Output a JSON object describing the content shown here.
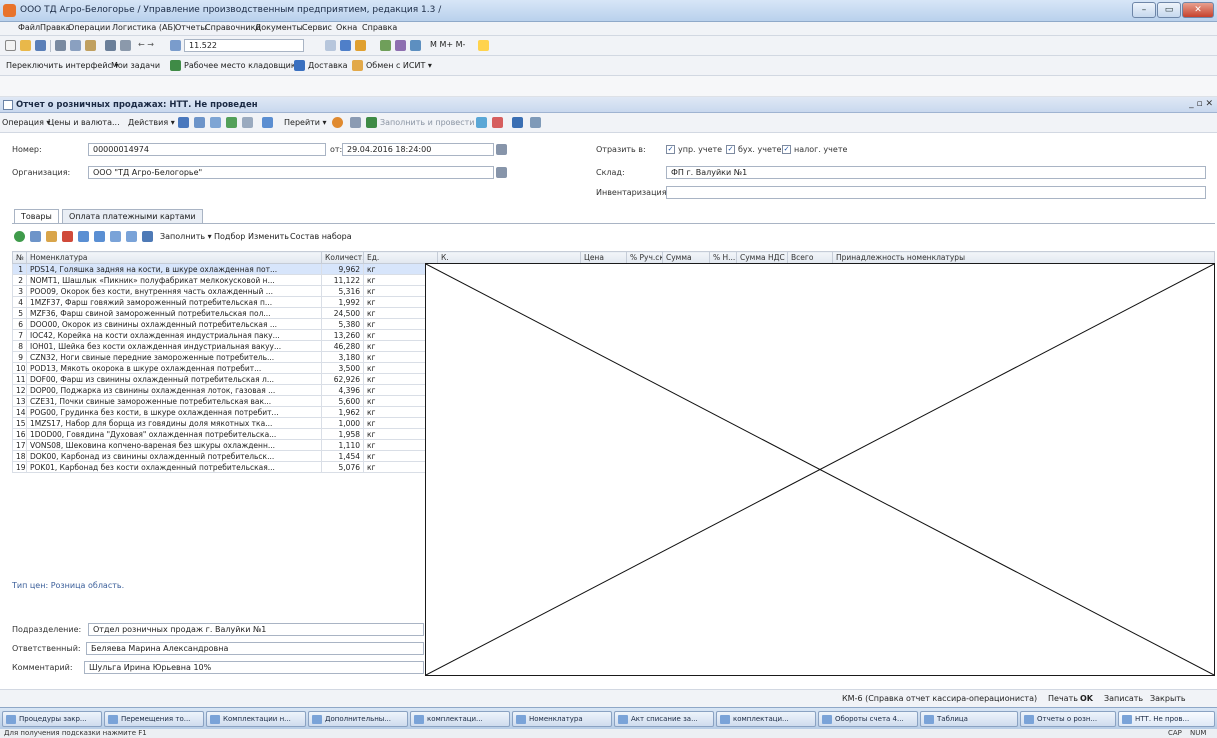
{
  "window": {
    "title": "ООО ТД Агро-Белогорье / Управление производственным предприятием, редакция 1.3 /",
    "min": "–",
    "max": "▭",
    "close": "✕"
  },
  "menu": [
    "Файл",
    "Правка",
    "Операции",
    "Логистика (АБ)",
    "Отчеты",
    "Справочники",
    "Документы",
    "Сервис",
    "Окна",
    "Справка"
  ],
  "toolbar1": {
    "search_value": "11.522",
    "calc": "M  M+  M-"
  },
  "toolbar2": {
    "switch_interface": "Переключить интерфейс ▾",
    "my_tasks": "Мои задачи",
    "warehouse": "Рабочее место кладовщика",
    "delivery": "Доставка",
    "exchange": "Обмен с ИСИТ ▾"
  },
  "doc": {
    "title": "Отчет о розничных продажах: НТТ. Не проведен",
    "close_controls": "_ ▫ ✕"
  },
  "doc_toolbar": {
    "operation": "Операция ▾",
    "prices": "Цены и валюта...",
    "actions": "Действия ▾",
    "goto": "Перейти ▾",
    "fill_post": "Заполнить и провести"
  },
  "form": {
    "number_label": "Номер:",
    "number_value": "00000014974",
    "date_label": "от:",
    "date_value": "29.04.2016 18:24:00",
    "org_label": "Организация:",
    "org_value": "ООО \"ТД Агро-Белогорье\"",
    "reflect_label": "Отразить в:",
    "reflect_mgmt": "упр. учете",
    "reflect_acc": "бух. учете",
    "reflect_tax": "налог. учете",
    "warehouse_label": "Склад:",
    "warehouse_value": "ФП г. Валуйки №1",
    "inventory_label": "Инвентаризация:",
    "inventory_value": ""
  },
  "tabs": [
    "Товары",
    "Оплата платежными картами"
  ],
  "grid_toolbar": {
    "fill": "Заполнить ▾",
    "pick": "Подбор",
    "change": "Изменить",
    "set": "Состав набора"
  },
  "grid": {
    "columns": [
      "№",
      "Номенклатура",
      "Количест...",
      "Ед.",
      "К.",
      "Цена",
      "% Руч.ск.",
      "Сумма",
      "% Н...",
      "Сумма НДС",
      "Всего",
      "Принадлежность номенклатуры"
    ],
    "rows": [
      [
        "1",
        "PDS14, Голяшка задняя на кости, в шкуре охлажденная пот...",
        "9,962",
        "кг"
      ],
      [
        "2",
        "NOMT1, Шашлык «Пикник» полуфабрикат мелкокусковой н...",
        "11,122",
        "кг"
      ],
      [
        "3",
        "POO09, Окорок без кости, внутренняя часть охлажденный ...",
        "5,316",
        "кг"
      ],
      [
        "4",
        "1MZF37, Фарш говяжий замороженный потребительская п...",
        "1,992",
        "кг"
      ],
      [
        "5",
        "MZF36, Фарш свиной замороженный потребительская пол...",
        "24,500",
        "кг"
      ],
      [
        "6",
        "DOO00, Окорок из свинины охлажденный потребительская ...",
        "5,380",
        "кг"
      ],
      [
        "7",
        "IOC42, Корейка на кости охлажденная индустриальная паку...",
        "13,260",
        "кг"
      ],
      [
        "8",
        "IOH01, Шейка без кости охлажденная индустриальная вакуу...",
        "46,280",
        "кг"
      ],
      [
        "9",
        "CZN32, Ноги свиные передние замороженные потребитель...",
        "3,180",
        "кг"
      ],
      [
        "10",
        "POD13, Мякоть окорока в шкуре охлажденная потребит...",
        "3,500",
        "кг"
      ],
      [
        "11",
        "DOF00, Фарш из свинины охлажденный потребительская л...",
        "62,926",
        "кг"
      ],
      [
        "12",
        "DOP00, Поджарка из свинины охлажденная лоток, газовая ...",
        "4,396",
        "кг"
      ],
      [
        "13",
        "CZE31, Почки свиные замороженные потребительская вак...",
        "5,600",
        "кг"
      ],
      [
        "14",
        "POG00, Грудинка без кости, в шкуре охлажденная потребит...",
        "1,962",
        "кг"
      ],
      [
        "15",
        "1MZS17, Набор для борща из говядины доля мякотных тка...",
        "1,000",
        "кг"
      ],
      [
        "16",
        "1DOD00, Говядина \"Духовая\" охлажденная потребительска...",
        "1,958",
        "кг"
      ],
      [
        "17",
        "VONS08, Шековина копчено-вареная без шкуры охлажденн...",
        "1,110",
        "кг"
      ],
      [
        "18",
        "DOK00, Карбонад из свинины охлажденный потребительск...",
        "1,454",
        "кг"
      ],
      [
        "19",
        "POK01, Карбонад без кости охлажденный потребительская...",
        "5,076",
        "кг"
      ]
    ]
  },
  "price_type": "Тип цен: Розница область.",
  "footer": {
    "dept_label": "Подразделение:",
    "dept_value": "Отдел розничных продаж г. Валуйки №1",
    "resp_label": "Ответственный:",
    "resp_value": "Беляева Марина Александровна",
    "comment_label": "Комментарий:",
    "comment_value": "Шульга Ирина Юрьевна 10%"
  },
  "bottom_actions": {
    "km6": "КМ-6 (Справка отчет кассира-операциониста)",
    "print": "Печать",
    "ok": "OK",
    "save": "Записать",
    "close": "Закрыть"
  },
  "taskbar": [
    "Процедуры закр...",
    "Перемещения то...",
    "Комплектации н...",
    "Дополнительны...",
    "комплектаци...",
    "Номенклатура",
    "Акт списание за...",
    "комплектаци...",
    "Обороты счета 4...",
    "Таблица",
    "Отчеты о розн...",
    "НТТ. Не пров..."
  ],
  "status": {
    "hint": "Для получения подсказки нажмите F1",
    "caps": "CAP",
    "num": "NUM"
  }
}
